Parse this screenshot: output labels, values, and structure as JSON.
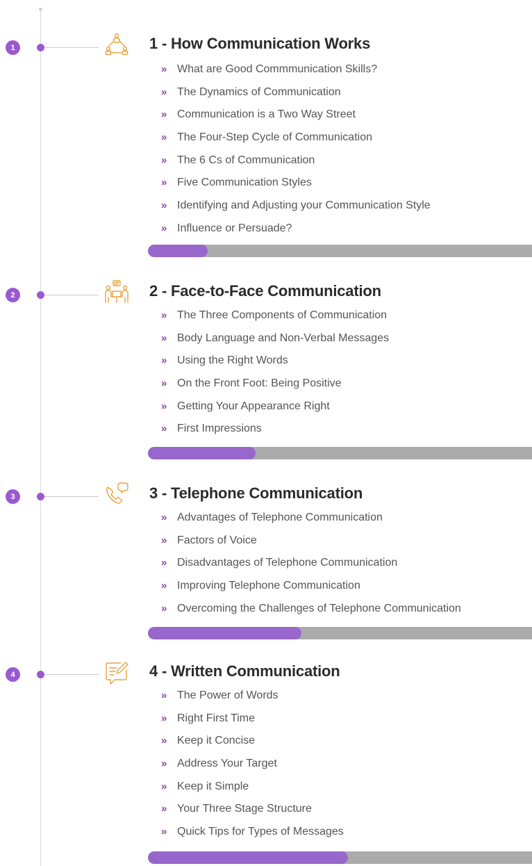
{
  "colors": {
    "accent": "#9b59d0",
    "chevron": "#8e44ad",
    "progress_fill": "#9966cc",
    "progress_track": "#ababab",
    "icon": "#e8a33d"
  },
  "modules": [
    {
      "number": "1",
      "title": "1 - How Communication Works",
      "icon": "network-people-icon",
      "progress": 0.155,
      "lessons": [
        "What are Good Commmunication Skills?",
        "The Dynamics of Communication",
        "Communication is a Two Way Street",
        "The Four-Step Cycle of Communication",
        "The 6 Cs of Communication",
        "Five Communication Styles",
        "Identifying and Adjusting your Communication Style",
        "Influence or Persuade?"
      ]
    },
    {
      "number": "2",
      "title": "2 - Face-to-Face Communication",
      "icon": "meeting-people-icon",
      "progress": 0.28,
      "lessons": [
        "The Three Components of Communication",
        "Body Language and Non-Verbal Messages",
        "Using the Right Words",
        "On the Front Foot: Being Positive",
        "Getting Your Appearance Right",
        "First Impressions"
      ]
    },
    {
      "number": "3",
      "title": "3 - Telephone Communication",
      "icon": "phone-chat-icon",
      "progress": 0.4,
      "lessons": [
        "Advantages of Telephone Communication",
        "Factors of Voice",
        "Disadvantages of Telephone Communication",
        "Improving Telephone Communication",
        "Overcoming the Challenges of Telephone Communication"
      ]
    },
    {
      "number": "4",
      "title": "4 - Written Communication",
      "icon": "edit-note-icon",
      "progress": 0.52,
      "lessons": [
        "The Power of Words",
        "Right First Time",
        "Keep it Concise",
        "Address Your Target",
        "Keep it Simple",
        "Your Three Stage Structure",
        "Quick Tips for Types of Messages"
      ]
    }
  ]
}
